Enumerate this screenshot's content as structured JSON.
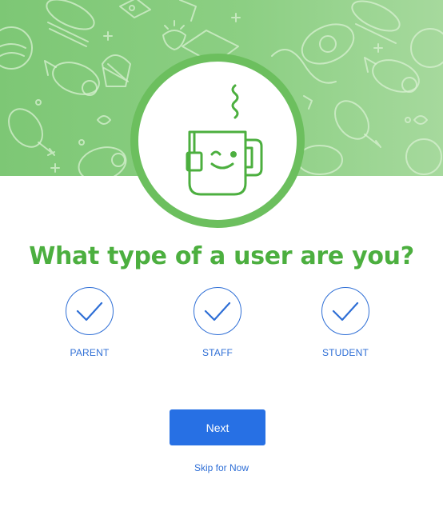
{
  "page": {
    "title": "What type of a user are you?"
  },
  "options": [
    {
      "label": "PARENT",
      "icon": "check-icon"
    },
    {
      "label": "STAFF",
      "icon": "check-icon"
    },
    {
      "label": "STUDENT",
      "icon": "check-icon"
    }
  ],
  "actions": {
    "next_label": "Next",
    "skip_label": "Skip for Now"
  },
  "colors": {
    "banner_green": "#8ccf83",
    "badge_green": "#6cbf5e",
    "title_green": "#4caf3f",
    "accent_blue": "#2770e4"
  }
}
